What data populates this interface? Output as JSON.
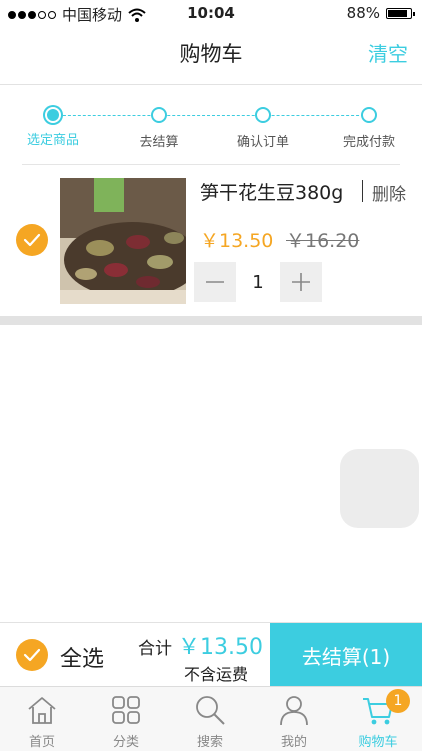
{
  "status_bar": {
    "carrier": "中国移动",
    "time": "10:04",
    "battery": "88%",
    "battery_level": 0.88,
    "signal_bars": 3
  },
  "nav": {
    "title": "购物车",
    "clear_label": "清空"
  },
  "steps": [
    {
      "label": "选定商品",
      "active": true
    },
    {
      "label": "去结算",
      "active": false
    },
    {
      "label": "确认订单",
      "active": false
    },
    {
      "label": "完成付款",
      "active": false
    }
  ],
  "cart_item": {
    "name": "笋干花生豆380g",
    "delete_label": "删除",
    "price": "￥13.50",
    "original_price": "￥16.20",
    "quantity": "1",
    "selected": true
  },
  "summary": {
    "select_all_label": "全选",
    "total_label": "合计",
    "total_value": "￥13.50",
    "shipping_note": "不含运费",
    "checkout_label": "去结算(1)"
  },
  "tabs": [
    {
      "label": "首页",
      "icon": "home-icon",
      "active": false
    },
    {
      "label": "分类",
      "icon": "category-grid-icon",
      "active": false
    },
    {
      "label": "搜索",
      "icon": "search-icon",
      "active": false
    },
    {
      "label": "我的",
      "icon": "user-icon",
      "active": false
    },
    {
      "label": "购物车",
      "icon": "cart-icon",
      "active": true,
      "badge": "1"
    }
  ],
  "colors": {
    "accent": "#3ccde0",
    "price": "#f5a623",
    "check": "#f5a623"
  }
}
